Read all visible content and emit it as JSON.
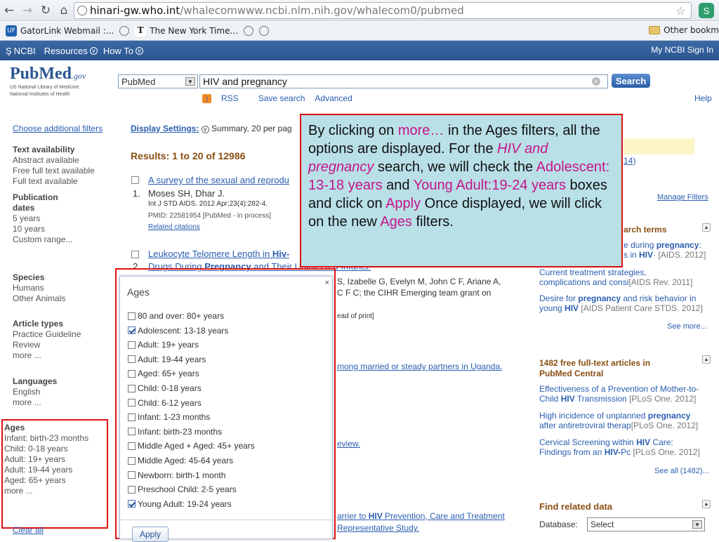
{
  "browser": {
    "url_host": "hinari-gw.who.int",
    "url_path": "/whalecomwww.ncbi.nlm.nih.gov/whalecom0/pubmed",
    "bookmarks": [
      "GatorLink Webmail :...",
      "The New York Time..."
    ],
    "other_bookmarks": "Other bookm"
  },
  "ncbi": {
    "brand": "NCBI",
    "resources": "Resources",
    "howto": "How To",
    "right": "My NCBI  Sign In"
  },
  "logo": {
    "pub": "PubMed",
    "gov": ".gov",
    "nlm1": "US National Library of Medicine",
    "nlm2": "National Institutes of Health"
  },
  "search": {
    "database": "PubMed",
    "query": "HIV and pregnancy",
    "button": "Search",
    "rss": "RSS",
    "save": "Save search",
    "advanced": "Advanced",
    "help": "Help"
  },
  "left": {
    "choose": "Choose additional filters",
    "text_avail": {
      "h": "Text availability",
      "items": [
        "Abstract available",
        "Free full text available",
        "Full text available"
      ]
    },
    "pub_dates": {
      "h1": "Publication",
      "h2": "dates",
      "items": [
        "5 years",
        "10 years",
        "Custom range..."
      ]
    },
    "species": {
      "h": "Species",
      "items": [
        "Humans",
        "Other Animals"
      ]
    },
    "article_types": {
      "h": "Article types",
      "items": [
        "Practice Guideline",
        "Review",
        "more ..."
      ]
    },
    "languages": {
      "h": "Languages",
      "items": [
        "English",
        "more ..."
      ]
    },
    "ages": {
      "h": "Ages",
      "items": [
        "Infant: birth-23 months",
        "Child: 0-18 years",
        "Adult: 19+ years",
        "Adult: 19-44 years",
        "Aged: 65+ years",
        "more ..."
      ]
    },
    "clear": "Clear all"
  },
  "results": {
    "display": "Display Settings:",
    "display_val": "Summary, 20 per pag",
    "count": "Results: 1 to 20 of 12986",
    "r1_title": "A survey of the sexual and reprodu",
    "r1_num": "1.",
    "r1_auth": "Moses SH, Dhar J.",
    "r1_src": "Int J STD AIDS. 2012 Apr;23(4):282-4.",
    "r1_pmid": "PMID: 22581954 [PubMed - in process]",
    "r1_rel": "Related citations",
    "r2_title_a": "Leukocyte Telomere Length in ",
    "r2_title_b": "Hiv-",
    "r2_num": "2.",
    "r2_line2a": "Drugs During ",
    "r2_line2b": "Pregnancy",
    "r2_line2c": " and Their Uninfected Infants.",
    "r2_auth": "S, Izabelle G, Evelyn M, John C F, Ariane A,",
    "r2_auth2": "C F C; the CIHR Emerging team grant on",
    "r2_src": "ead of print]",
    "r3_title": "mong married or steady partners in Uganda.",
    "r4_title": "eview.",
    "r5_title_a": "arrier to ",
    "r5_title_b": "HIV",
    "r5_title_c": " Prevention, Care and Treatment",
    "r5_line2": "Representative Study."
  },
  "right": {
    "r_hint": "14)",
    "manage": "Manage Filters",
    "terms_head": "arch terms",
    "t1a": "e during ",
    "t1b": "pregnancy",
    "t1c": ":",
    "t2a": "s in ",
    "t2b": "HIV",
    "t2c": "·",
    "t2m": "[AIDS. 2012]",
    "t3": "Current treatment strategies,",
    "t4": "complications and consi",
    "t4m": "[AIDS Rev. 2011]",
    "t5a": "Desire for ",
    "t5b": "pregnancy",
    "t5c": " and risk behavior in",
    "t6a": "young ",
    "t6b": "HIV",
    "t6m": "[AIDS Patient Care STDS. 2012]",
    "see_more": "See more...",
    "pmc_head1": "1482 free full-text articles in",
    "pmc_head2": "PubMed Central",
    "p1": "Effectiveness of a Prevention of Mother-to-",
    "p2a": "Child ",
    "p2b": "HIV",
    "p2c": " Transmission ",
    "p2m": "[PLoS One. 2012]",
    "p3a": "High incidence of unplanned ",
    "p3b": "pregnancy",
    "p4": "after antiretroviral therap",
    "p4m": "[PLoS One. 2012]",
    "p5a": "Cervical Screening within ",
    "p5b": "HIV",
    "p5c": " Care:",
    "p6a": "Findings from an ",
    "p6b": "HIV-",
    "p6c": "Pc",
    "p6m": "[PLoS One. 2012]",
    "see_all": "See all (1482)...",
    "related_head": "Find related data",
    "db_label": "Database:",
    "db_value": "Select"
  },
  "callout": {
    "p1": "By clicking on ",
    "more": "more…",
    "p2": " in the Ages filters, all the options are displayed. For the ",
    "hiv": "HIV and pregnancy",
    "p3": " search, we will check the ",
    "adol": "Adolescent: 13-18 years",
    "p4": " and ",
    "young": "Young Adult:19-24 years",
    "p5": " boxes and click on ",
    "apply": "Apply",
    "p6": " Once displayed, we will click on the new ",
    "ages": "Ages",
    "p7": " filters."
  },
  "popup": {
    "title": "Ages",
    "close": "×",
    "options": [
      {
        "label": "80 and over: 80+ years",
        "checked": false
      },
      {
        "label": "Adolescent: 13-18 years",
        "checked": true
      },
      {
        "label": "Adult: 19+ years",
        "checked": false
      },
      {
        "label": "Adult: 19-44 years",
        "checked": false
      },
      {
        "label": "Aged: 65+ years",
        "checked": false
      },
      {
        "label": "Child: 0-18 years",
        "checked": false
      },
      {
        "label": "Child: 6-12 years",
        "checked": false
      },
      {
        "label": "Infant: 1-23 months",
        "checked": false
      },
      {
        "label": "Infant: birth-23 months",
        "checked": false
      },
      {
        "label": "Middle Aged + Aged: 45+ years",
        "checked": false
      },
      {
        "label": "Middle Aged: 45-64 years",
        "checked": false
      },
      {
        "label": "Newborn: birth-1 month",
        "checked": false
      },
      {
        "label": "Preschool Child: 2-5 years",
        "checked": false
      },
      {
        "label": "Young Adult: 19-24 years",
        "checked": true
      }
    ],
    "apply": "Apply"
  },
  "colors": {
    "highlight": "#c4168a",
    "callout_bg": "#b9dfe7",
    "frame": "#dd1111",
    "link": "#2a5db0"
  }
}
